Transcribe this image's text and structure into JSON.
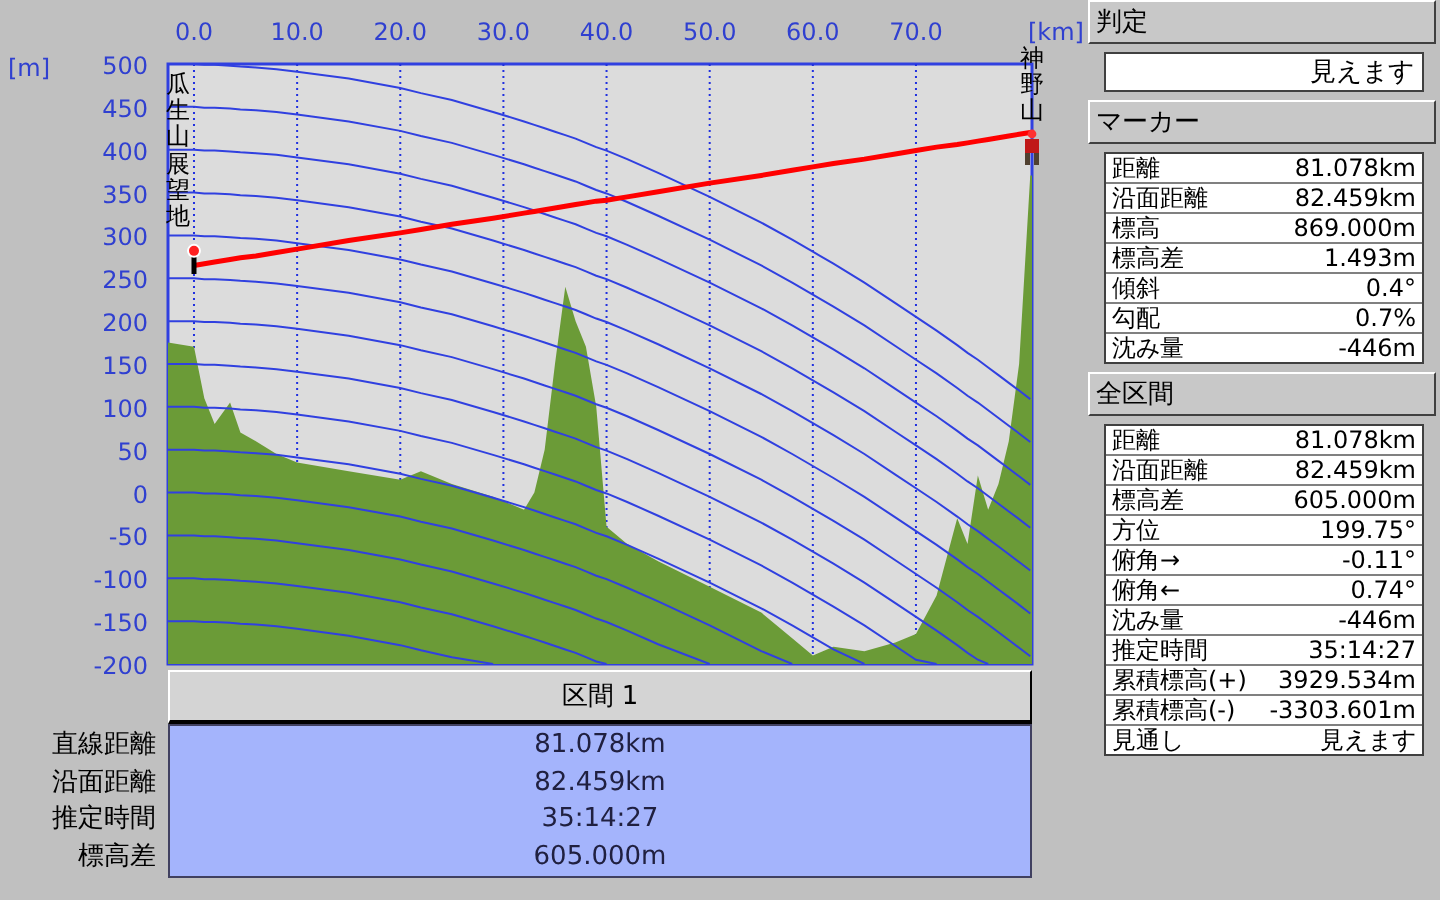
{
  "chart": {
    "start_point": {
      "label": "瓜生山展望地"
    },
    "end_point": {
      "label": "神野山"
    },
    "chart_data": {
      "type": "area",
      "xlabel": "[km]",
      "ylabel": "[m]",
      "x": [
        -2.52,
        0,
        1,
        2,
        3.5,
        4.5,
        6,
        8,
        10,
        15,
        20,
        22,
        25,
        29,
        32,
        33,
        34,
        35,
        36,
        37,
        38,
        39,
        40,
        42,
        45,
        50,
        55,
        58,
        60,
        62,
        65,
        68,
        70,
        72,
        74,
        75,
        76,
        77,
        78,
        79,
        80,
        81.08
      ],
      "series": [
        {
          "color": "#6b9b37",
          "values": [
            175,
            170,
            110,
            80,
            105,
            70,
            60,
            45,
            35,
            25,
            15,
            25,
            10,
            -5,
            -20,
            0,
            50,
            150,
            240,
            200,
            170,
            100,
            -40,
            -60,
            -80,
            -110,
            -140,
            -170,
            -190,
            -180,
            -185,
            -175,
            -165,
            -120,
            -30,
            -60,
            20,
            -20,
            10,
            60,
            150,
            370
          ]
        },
        {
          "type": "line",
          "color": "#ff0000",
          "values": [
            null,
            265,
            267,
            269,
            272,
            274,
            276,
            280,
            284,
            294,
            303,
            307,
            313,
            320,
            326,
            328,
            330,
            332,
            334,
            336,
            338,
            340,
            341,
            345,
            351,
            361,
            370,
            376,
            380,
            384,
            389,
            395,
            399,
            403,
            406,
            408,
            410,
            412,
            414,
            416,
            418,
            420
          ]
        },
        {
          "type": "line",
          "color": "#3040e0",
          "values": [
            500,
            500,
            499,
            499,
            498,
            497,
            496,
            494,
            491,
            483,
            472,
            466,
            458,
            444,
            433,
            429,
            425,
            421,
            417,
            413,
            408,
            403,
            399,
            389,
            373,
            345,
            315,
            295,
            281,
            267,
            245,
            221,
            205,
            189,
            172,
            163,
            155,
            146,
            137,
            128,
            119,
            109
          ]
        },
        {
          "type": "line",
          "color": "#3040e0",
          "values": [
            450,
            450,
            449,
            449,
            448,
            447,
            446,
            444,
            441,
            433,
            422,
            416,
            408,
            394,
            383,
            379,
            375,
            371,
            367,
            363,
            358,
            353,
            349,
            339,
            323,
            295,
            265,
            245,
            231,
            217,
            195,
            171,
            155,
            139,
            122,
            113,
            105,
            96,
            87,
            78,
            69,
            59
          ]
        },
        {
          "type": "line",
          "color": "#3040e0",
          "values": [
            400,
            400,
            399,
            399,
            398,
            397,
            396,
            394,
            391,
            383,
            372,
            366,
            358,
            344,
            333,
            329,
            325,
            321,
            317,
            313,
            308,
            303,
            299,
            289,
            273,
            245,
            215,
            195,
            181,
            167,
            145,
            121,
            105,
            89,
            72,
            63,
            55,
            46,
            37,
            28,
            19,
            9
          ]
        },
        {
          "type": "line",
          "color": "#3040e0",
          "values": [
            350,
            350,
            349,
            349,
            348,
            347,
            346,
            344,
            341,
            333,
            322,
            316,
            308,
            294,
            283,
            279,
            275,
            271,
            267,
            263,
            258,
            253,
            249,
            239,
            223,
            195,
            165,
            145,
            131,
            117,
            95,
            71,
            55,
            39,
            22,
            13,
            5,
            -4,
            -13,
            -22,
            -31,
            -41
          ]
        },
        {
          "type": "line",
          "color": "#3040e0",
          "values": [
            300,
            300,
            299,
            299,
            298,
            297,
            296,
            294,
            291,
            283,
            272,
            266,
            258,
            244,
            233,
            229,
            225,
            221,
            217,
            213,
            208,
            203,
            199,
            189,
            173,
            145,
            115,
            95,
            81,
            67,
            45,
            21,
            5,
            -11,
            -28,
            -37,
            -45,
            -54,
            -63,
            -72,
            -81,
            -91
          ]
        },
        {
          "type": "line",
          "color": "#3040e0",
          "values": [
            250,
            250,
            249,
            249,
            248,
            247,
            246,
            244,
            241,
            233,
            222,
            216,
            208,
            194,
            183,
            179,
            175,
            171,
            167,
            163,
            158,
            153,
            149,
            139,
            123,
            95,
            65,
            45,
            31,
            17,
            -5,
            -29,
            -45,
            -61,
            -78,
            -87,
            -95,
            -104,
            -113,
            -122,
            -131,
            -141
          ]
        },
        {
          "type": "line",
          "color": "#3040e0",
          "values": [
            200,
            200,
            199,
            199,
            198,
            197,
            196,
            194,
            191,
            183,
            172,
            166,
            158,
            144,
            133,
            129,
            125,
            121,
            117,
            113,
            108,
            103,
            99,
            89,
            73,
            45,
            15,
            -5,
            -19,
            -33,
            -55,
            -79,
            -95,
            -111,
            -128,
            -137,
            -145,
            -154,
            -163,
            -172,
            -181,
            -191
          ]
        },
        {
          "type": "line",
          "color": "#3040e0",
          "values": [
            150,
            150,
            149,
            149,
            148,
            147,
            146,
            144,
            141,
            133,
            122,
            116,
            108,
            94,
            83,
            79,
            75,
            71,
            67,
            63,
            58,
            53,
            49,
            39,
            23,
            -5,
            -35,
            -55,
            -69,
            -83,
            -105,
            -129,
            -145,
            -161,
            -178,
            -187,
            -195,
            -200,
            null,
            null,
            null,
            null
          ]
        },
        {
          "type": "line",
          "color": "#3040e0",
          "values": [
            100,
            100,
            99,
            99,
            98,
            97,
            96,
            94,
            91,
            83,
            72,
            66,
            58,
            44,
            33,
            29,
            25,
            21,
            17,
            13,
            8,
            3,
            -1,
            -11,
            -27,
            -55,
            -85,
            -105,
            -119,
            -133,
            -155,
            -179,
            -195,
            -200,
            null,
            null,
            null,
            null,
            null,
            null,
            null,
            null
          ]
        },
        {
          "type": "line",
          "color": "#3040e0",
          "values": [
            50,
            50,
            49,
            49,
            48,
            47,
            46,
            44,
            41,
            33,
            22,
            16,
            8,
            -6,
            -17,
            -21,
            -25,
            -29,
            -33,
            -37,
            -42,
            -47,
            -51,
            -61,
            -77,
            -105,
            -135,
            -155,
            -169,
            -183,
            -200,
            null,
            null,
            null,
            null,
            null,
            null,
            null,
            null,
            null,
            null,
            null
          ]
        },
        {
          "type": "line",
          "color": "#3040e0",
          "values": [
            0,
            0,
            -1,
            -1,
            -2,
            -3,
            -4,
            -6,
            -9,
            -17,
            -28,
            -34,
            -42,
            -56,
            -67,
            -71,
            -75,
            -79,
            -83,
            -87,
            -92,
            -97,
            -101,
            -111,
            -127,
            -155,
            -185,
            -200,
            null,
            null,
            null,
            null,
            null,
            null,
            null,
            null,
            null,
            null,
            null,
            null,
            null,
            null
          ]
        },
        {
          "type": "line",
          "color": "#3040e0",
          "values": [
            -50,
            -50,
            -51,
            -51,
            -52,
            -53,
            -54,
            -56,
            -59,
            -67,
            -78,
            -84,
            -92,
            -106,
            -117,
            -121,
            -125,
            -129,
            -133,
            -137,
            -142,
            -147,
            -151,
            -161,
            -177,
            -200,
            null,
            null,
            null,
            null,
            null,
            null,
            null,
            null,
            null,
            null,
            null,
            null,
            null,
            null,
            null,
            null
          ]
        },
        {
          "type": "line",
          "color": "#3040e0",
          "values": [
            -100,
            -100,
            -101,
            -101,
            -102,
            -103,
            -104,
            -106,
            -109,
            -117,
            -128,
            -134,
            -142,
            -156,
            -167,
            -171,
            -175,
            -179,
            -183,
            -187,
            -192,
            -197,
            -200,
            null,
            null,
            null,
            null,
            null,
            null,
            null,
            null,
            null,
            null,
            null,
            null,
            null,
            null,
            null,
            null,
            null,
            null,
            null
          ]
        },
        {
          "type": "line",
          "color": "#3040e0",
          "values": [
            -150,
            -150,
            -151,
            -151,
            -152,
            -153,
            -154,
            -156,
            -159,
            -167,
            -178,
            -184,
            -192,
            -200,
            null,
            null,
            null,
            null,
            null,
            null,
            null,
            null,
            null,
            null,
            null,
            null,
            null,
            null,
            null,
            null,
            null,
            null,
            null,
            null,
            null,
            null,
            null,
            null,
            null,
            null,
            null,
            null
          ]
        }
      ],
      "xlim": [
        -2.52,
        81.25
      ],
      "ylim": [
        -200,
        500
      ],
      "grid": true,
      "xticks": [
        {
          "value": 0,
          "label": "0.0"
        },
        {
          "value": 10,
          "label": "10.0"
        },
        {
          "value": 20,
          "label": "20.0"
        },
        {
          "value": 30,
          "label": "30.0"
        },
        {
          "value": 40,
          "label": "40.0"
        },
        {
          "value": 50,
          "label": "50.0"
        },
        {
          "value": 60,
          "label": "60.0"
        },
        {
          "value": 70,
          "label": "70.0"
        }
      ],
      "yticks": [
        500,
        450,
        400,
        350,
        300,
        250,
        200,
        150,
        100,
        50,
        0,
        -50,
        -100,
        -150,
        -200
      ]
    }
  },
  "section": {
    "title": "区間 1",
    "rows": [
      {
        "label": "直線距離",
        "value": "81.078km"
      },
      {
        "label": "沿面距離",
        "value": "82.459km"
      },
      {
        "label": "推定時間",
        "value": "35:14:27"
      },
      {
        "label": "標高差",
        "value": "605.000m"
      }
    ]
  },
  "judgement": {
    "title": "判定",
    "value": "見えます"
  },
  "marker": {
    "title": "マーカー",
    "rows": [
      {
        "label": "距離",
        "value": "81.078km"
      },
      {
        "label": "沿面距離",
        "value": "82.459km"
      },
      {
        "label": "標高",
        "value": "869.000m"
      },
      {
        "label": "標高差",
        "value": "1.493m"
      },
      {
        "label": "傾斜",
        "value": "0.4°"
      },
      {
        "label": "勾配",
        "value": "0.7%"
      },
      {
        "label": "沈み量",
        "value": "-446m"
      }
    ]
  },
  "total": {
    "title": "全区間",
    "rows": [
      {
        "label": "距離",
        "value": "81.078km"
      },
      {
        "label": "沿面距離",
        "value": "82.459km"
      },
      {
        "label": "標高差",
        "value": "605.000m"
      },
      {
        "label": "方位",
        "value": "199.75°"
      },
      {
        "label": "俯角→",
        "value": "-0.11°"
      },
      {
        "label": "俯角←",
        "value": "0.74°"
      },
      {
        "label": "沈み量",
        "value": "-446m"
      },
      {
        "label": "推定時間",
        "value": "35:14:27"
      },
      {
        "label": "累積標高(+)",
        "value": "3929.534m"
      },
      {
        "label": "累積標高(-)",
        "value": "-3303.601m"
      },
      {
        "label": "見通し",
        "value": "見えます"
      }
    ]
  }
}
